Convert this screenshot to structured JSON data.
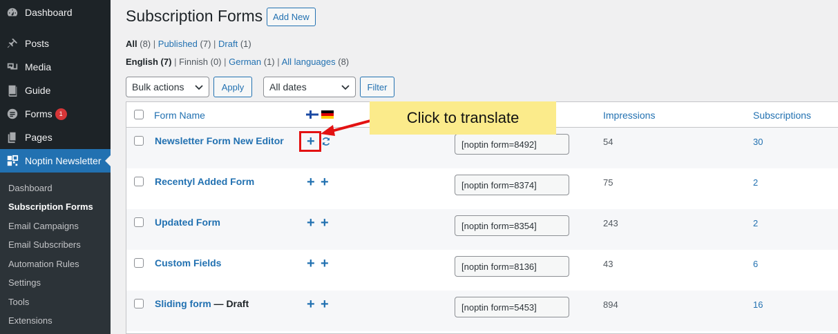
{
  "sidebar": {
    "top_items": [
      {
        "label": "Dashboard",
        "icon": "dashboard-icon"
      },
      {
        "label": "Posts",
        "icon": "pin-icon"
      },
      {
        "label": "Media",
        "icon": "media-icon"
      },
      {
        "label": "Guide",
        "icon": "book-icon"
      },
      {
        "label": "Forms",
        "icon": "forms-icon",
        "badge": "1"
      },
      {
        "label": "Pages",
        "icon": "pages-icon"
      },
      {
        "label": "Noptin Newsletter",
        "icon": "grid-icon"
      }
    ],
    "sub_items": [
      "Dashboard",
      "Subscription Forms",
      "Email Campaigns",
      "Email Subscribers",
      "Automation Rules",
      "Settings",
      "Tools",
      "Extensions"
    ]
  },
  "header": {
    "title": "Subscription Forms",
    "add_new": "Add New"
  },
  "status_filters": {
    "all": "All",
    "all_count": "(8)",
    "published": "Published",
    "published_count": "(7)",
    "draft": "Draft",
    "draft_count": "(1)",
    "sep": "|"
  },
  "language_filters": {
    "english": "English (7)",
    "finnish": "Finnish (0)",
    "german": "German",
    "german_count": "(1)",
    "all_languages": "All languages",
    "all_languages_count": "(8)",
    "sep": "|"
  },
  "toolbar": {
    "bulk_actions": "Bulk actions",
    "apply": "Apply",
    "all_dates": "All dates",
    "filter": "Filter"
  },
  "table": {
    "columns": {
      "name": "Form Name",
      "impressions": "Impressions",
      "subscriptions": "Subscriptions"
    },
    "rows": [
      {
        "name": "Newsletter Form New Editor",
        "state": "",
        "shortcode": "[noptin form=8492]",
        "impressions": "54",
        "subscriptions": "30"
      },
      {
        "name": "Recentyl Added Form",
        "state": "",
        "shortcode": "[noptin form=8374]",
        "impressions": "75",
        "subscriptions": "2"
      },
      {
        "name": "Updated Form",
        "state": "",
        "shortcode": "[noptin form=8354]",
        "impressions": "243",
        "subscriptions": "2"
      },
      {
        "name": "Custom Fields",
        "state": "",
        "shortcode": "[noptin form=8136]",
        "impressions": "43",
        "subscriptions": "6"
      },
      {
        "name": "Sliding form",
        "state": " — Draft",
        "shortcode": "[noptin form=5453]",
        "impressions": "894",
        "subscriptions": "16"
      }
    ]
  },
  "annotation": {
    "callout": "Click to translate"
  },
  "colors": {
    "accent": "#2271b1",
    "sidebar_bg": "#1d2327",
    "callout_bg": "#fbeb8b",
    "highlight": "#e31212"
  }
}
